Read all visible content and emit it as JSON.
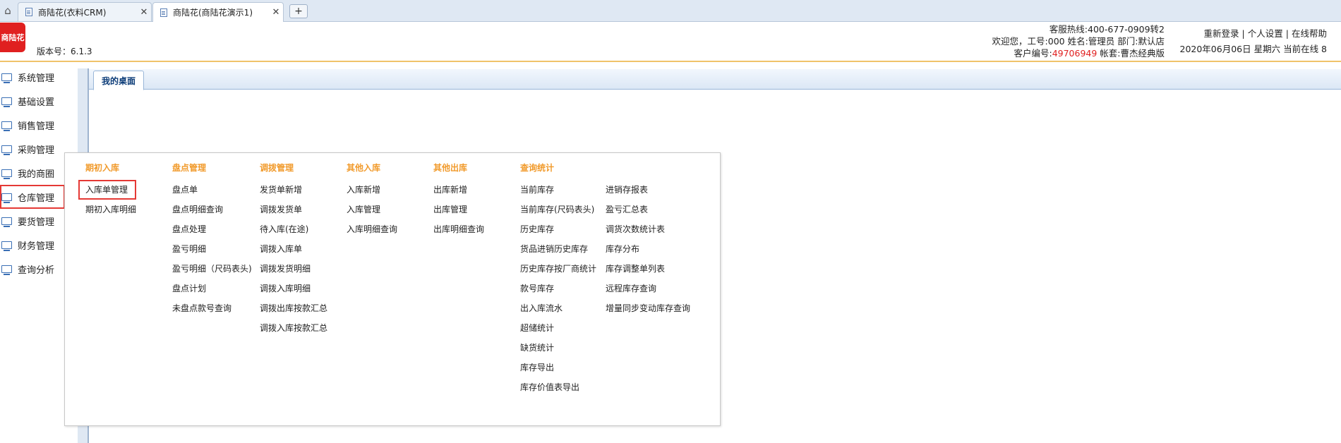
{
  "browser": {
    "tabs": [
      {
        "label": "商陆花(衣料CRM)",
        "active": false
      },
      {
        "label": "商陆花(商陆花演示1)",
        "active": true
      }
    ],
    "close_glyph": "✕",
    "newtab_glyph": "+",
    "home_glyph": "⌂"
  },
  "header": {
    "logo_text": "商陆花",
    "version": "版本号：6.1.3",
    "hotline": "客服热线:400-677-0909转2",
    "welcome": "欢迎您，工号:000 姓名:管理员 部门:默认店",
    "customer_prefix": "客户编号:",
    "customer_no": "49706949",
    "account_set": " 帐套:曹杰经典版",
    "links": {
      "relogin": "重新登录",
      "settings": "个人设置",
      "help": "在线帮助",
      "separator": "|"
    },
    "date_line": "2020年06月06日 星期六 当前在线 8"
  },
  "sidebar": {
    "items": [
      {
        "label": "系统管理"
      },
      {
        "label": "基础设置"
      },
      {
        "label": "销售管理"
      },
      {
        "label": "采购管理"
      },
      {
        "label": "我的商圈"
      },
      {
        "label": "仓库管理"
      },
      {
        "label": "要货管理"
      },
      {
        "label": "财务管理"
      },
      {
        "label": "查询分析"
      }
    ]
  },
  "main": {
    "desk_tab": "我的桌面"
  },
  "mega_menu": {
    "columns": [
      {
        "title": "期初入库",
        "items": [
          "入库单管理",
          "期初入库明细"
        ]
      },
      {
        "title": "盘点管理",
        "items": [
          "盘点单",
          "盘点明细查询",
          "盘点处理",
          "盈亏明细",
          "盈亏明细（尺码表头)",
          "盘点计划",
          "未盘点款号查询"
        ]
      },
      {
        "title": "调拨管理",
        "items": [
          "发货单新增",
          "调拨发货单",
          "待入库(在途)",
          "调拨入库单",
          "调拨发货明细",
          "调拨入库明细",
          "调拨出库按款汇总",
          "调拨入库按款汇总"
        ]
      },
      {
        "title": "其他入库",
        "items": [
          "入库新增",
          "入库管理",
          "入库明细查询"
        ]
      },
      {
        "title": "其他出库",
        "items": [
          "出库新增",
          "出库管理",
          "出库明细查询"
        ]
      },
      {
        "title": "查询统计",
        "items": [
          "当前库存",
          "当前库存(尺码表头)",
          "历史库存",
          "货品进销历史库存",
          "历史库存按厂商统计",
          "款号库存",
          "出入库流水",
          "超储统计",
          "缺货统计",
          "库存导出",
          "库存价值表导出"
        ]
      },
      {
        "title": "",
        "items": [
          "进销存报表",
          "盈亏汇总表",
          "调货次数统计表",
          "库存分布",
          "库存调整单列表",
          "远程库存查询",
          "增量同步变动库存查询"
        ]
      }
    ]
  }
}
